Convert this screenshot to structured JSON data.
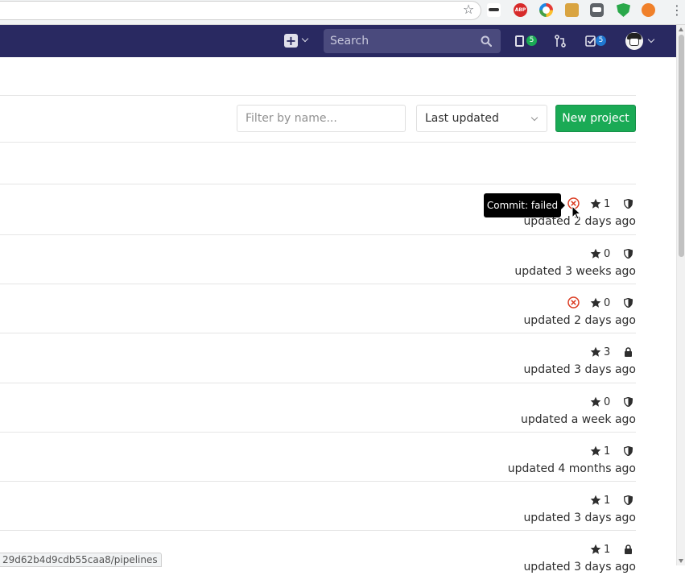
{
  "browser": {
    "extensions": [
      "star-icon",
      "spy-glasses-icon",
      "adblock-plus-icon",
      "color-picker-icon",
      "face-icon",
      "chat-icon",
      "shield-icon",
      "orange-circle-icon"
    ],
    "abp_label": "ABP",
    "status_url": "29d62b4d9cdb55caa8/pipelines"
  },
  "navbar": {
    "background": "#292961",
    "search_placeholder": "Search",
    "issues_count": "5",
    "todos_count": "5"
  },
  "toolbar": {
    "filter_placeholder": "Filter by name...",
    "sort_label": "Last updated",
    "new_project_label": "New project"
  },
  "tooltip": {
    "text": "Commit: failed"
  },
  "projects": [
    {
      "status": "failed",
      "stars": "1",
      "visibility": "internal",
      "updated": "updated 2 days ago"
    },
    {
      "status": "",
      "stars": "0",
      "visibility": "internal",
      "updated": "updated 3 weeks ago"
    },
    {
      "status": "failed",
      "stars": "0",
      "visibility": "internal",
      "updated": "updated 2 days ago"
    },
    {
      "status": "",
      "stars": "3",
      "visibility": "private",
      "updated": "updated 3 days ago"
    },
    {
      "status": "",
      "stars": "0",
      "visibility": "internal",
      "updated": "updated a week ago"
    },
    {
      "status": "",
      "stars": "1",
      "visibility": "internal",
      "updated": "updated 4 months ago"
    },
    {
      "status": "",
      "stars": "1",
      "visibility": "internal",
      "updated": "updated 3 days ago"
    },
    {
      "status": "",
      "stars": "1",
      "visibility": "private",
      "updated": "updated 3 days ago"
    }
  ],
  "colors": {
    "success": "#1aaa55",
    "failed": "#db3b21",
    "info": "#1f78d1"
  }
}
